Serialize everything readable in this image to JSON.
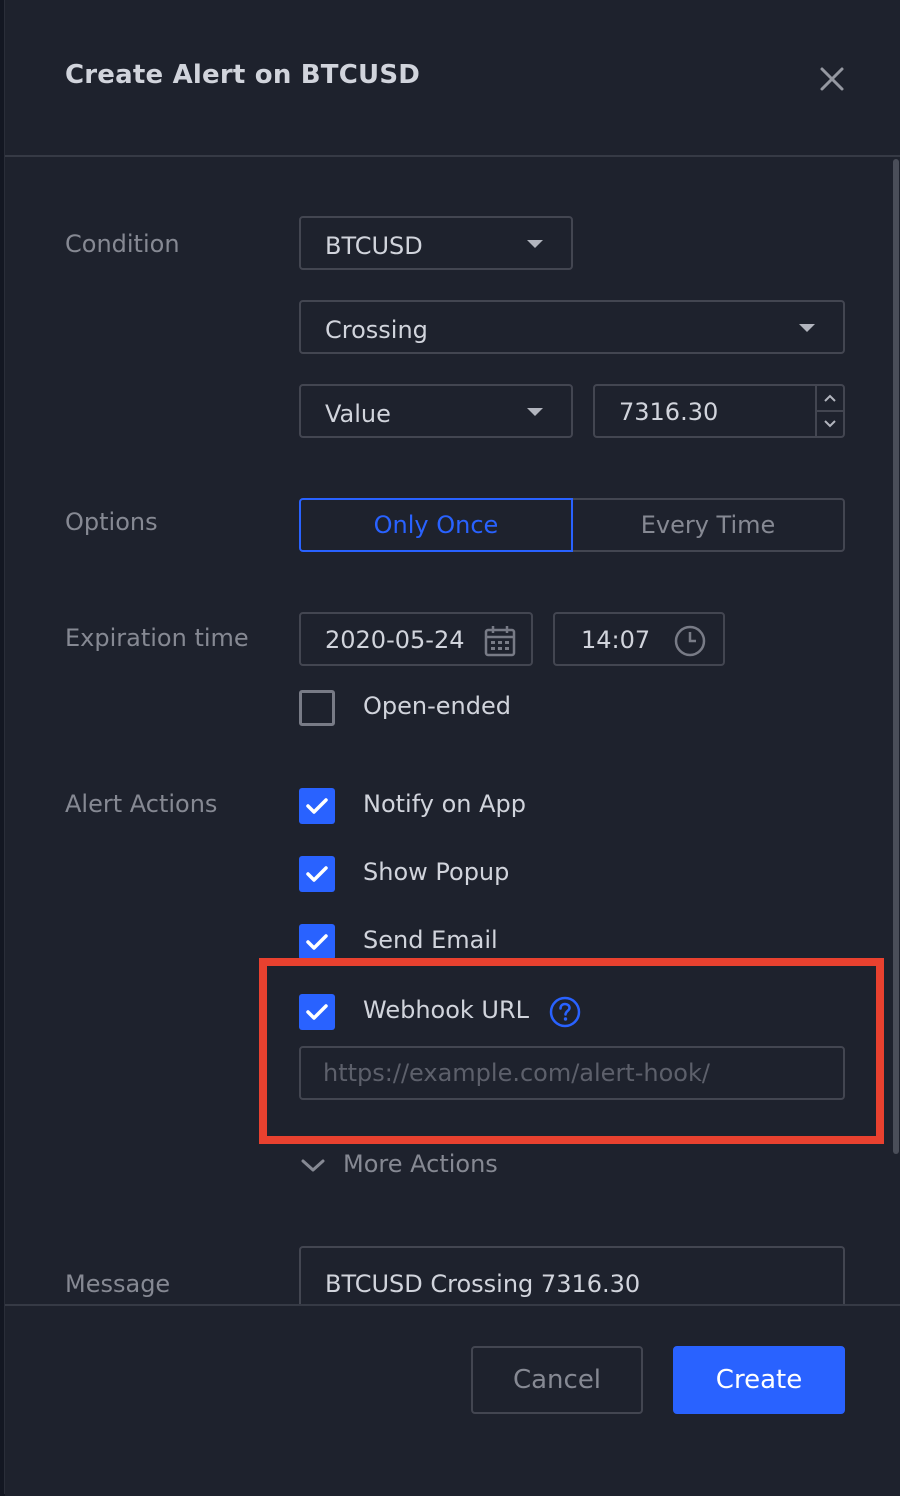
{
  "dialog": {
    "title": "Create Alert on BTCUSD",
    "close_icon": "close-icon"
  },
  "condition": {
    "label": "Condition",
    "symbol": "BTCUSD",
    "operator": "Crossing",
    "value_type": "Value",
    "value": "7316.30"
  },
  "options": {
    "label": "Options",
    "only_once": "Only Once",
    "every_time": "Every Time",
    "selected": "Only Once"
  },
  "expiration": {
    "label": "Expiration time",
    "date": "2020-05-24",
    "time": "14:07",
    "open_ended_label": "Open-ended",
    "open_ended_checked": false
  },
  "alert_actions": {
    "label": "Alert Actions",
    "items": [
      {
        "label": "Notify on App",
        "checked": true
      },
      {
        "label": "Show Popup",
        "checked": true
      },
      {
        "label": "Send Email",
        "checked": true
      },
      {
        "label": "Webhook URL",
        "checked": true
      }
    ],
    "webhook_placeholder": "https://example.com/alert-hook/",
    "more_actions": "More Actions"
  },
  "message": {
    "label": "Message",
    "value": "BTCUSD Crossing 7316.30"
  },
  "footer": {
    "cancel": "Cancel",
    "create": "Create"
  },
  "colors": {
    "accent": "#2962ff",
    "highlight": "#e8412f",
    "background": "#1e222d"
  }
}
